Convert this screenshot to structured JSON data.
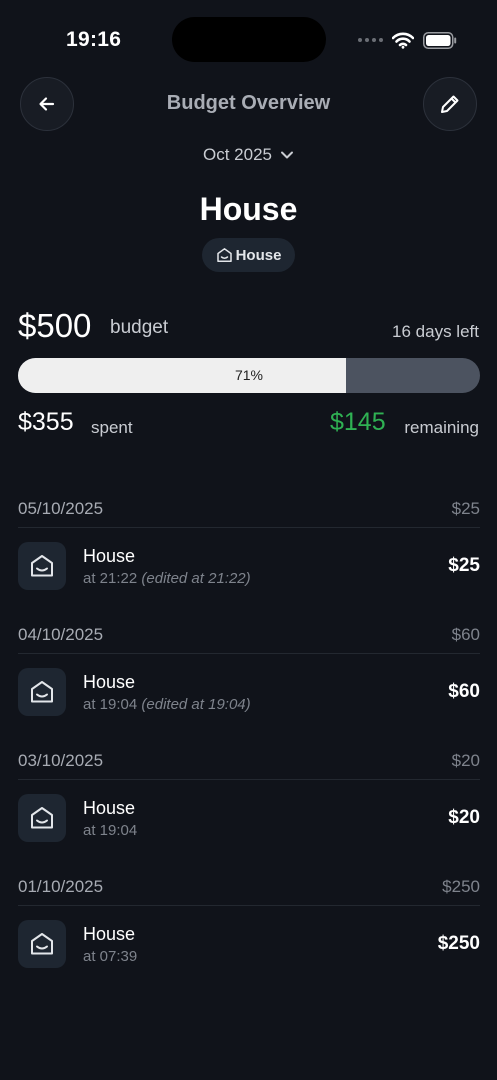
{
  "status_bar": {
    "time": "19:16"
  },
  "header": {
    "title": "Budget Overview"
  },
  "month_selector": {
    "label": "Oct 2025"
  },
  "budget": {
    "name": "House",
    "category_chip": "House",
    "amount": "$500",
    "amount_label": "budget",
    "days_left": "16 days left",
    "progress_percent": 71,
    "progress_label": "71%",
    "spent": "$355",
    "spent_label": "spent",
    "remaining": "$145",
    "remaining_label": "remaining",
    "remaining_color": "#2fb153"
  },
  "transactions": [
    {
      "date": "05/10/2025",
      "day_total": "$25",
      "items": [
        {
          "name": "House",
          "time": "at 21:22",
          "edited": "(edited at 21:22)",
          "amount": "$25",
          "icon": "house-icon"
        }
      ]
    },
    {
      "date": "04/10/2025",
      "day_total": "$60",
      "items": [
        {
          "name": "House",
          "time": "at 19:04",
          "edited": "(edited at 19:04)",
          "amount": "$60",
          "icon": "house-icon"
        }
      ]
    },
    {
      "date": "03/10/2025",
      "day_total": "$20",
      "items": [
        {
          "name": "House",
          "time": "at 19:04",
          "edited": "",
          "amount": "$20",
          "icon": "house-icon"
        }
      ]
    },
    {
      "date": "01/10/2025",
      "day_total": "$250",
      "items": [
        {
          "name": "House",
          "time": "at 07:39",
          "edited": "",
          "amount": "$250",
          "icon": "house-icon"
        }
      ]
    }
  ],
  "icons": {
    "back": "arrow-left-icon",
    "edit": "pencil-icon",
    "month_dropdown": "chevron-down-icon",
    "category": "house-icon"
  }
}
